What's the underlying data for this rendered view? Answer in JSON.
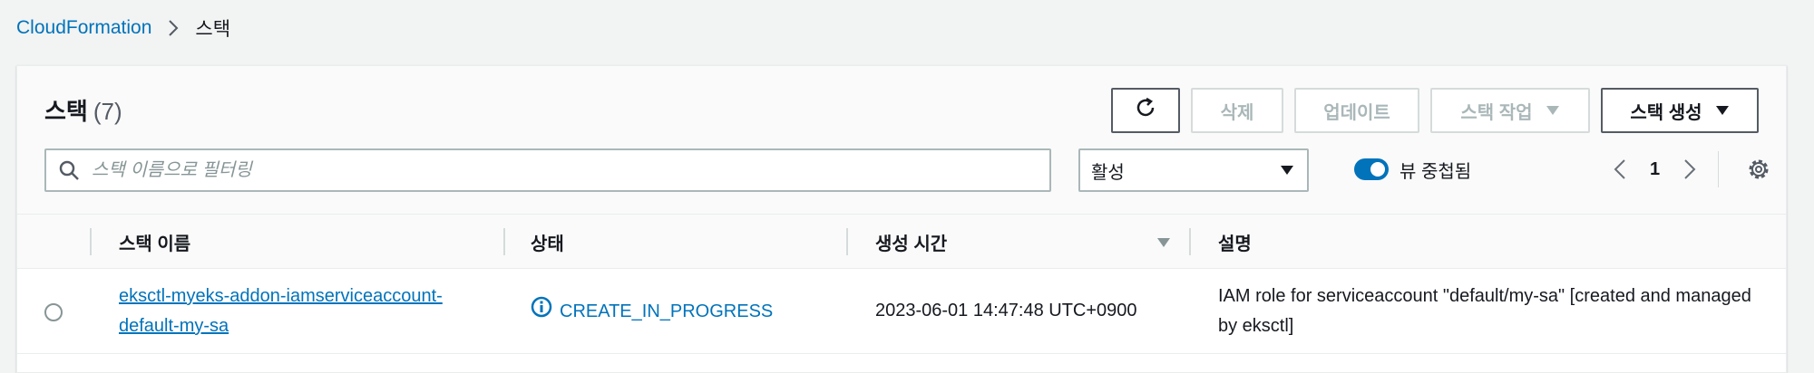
{
  "breadcrumb": {
    "root": "CloudFormation",
    "current": "스택"
  },
  "header": {
    "title": "스택",
    "count": "(7)"
  },
  "toolbar": {
    "delete_label": "삭제",
    "update_label": "업데이트",
    "stack_actions_label": "스택 작업",
    "create_stack_label": "스택 생성"
  },
  "filter": {
    "search_placeholder": "스택 이름으로 필터링",
    "status_select_value": "활성",
    "nested_view_label": "뷰 중첩됨",
    "nested_view_on": true
  },
  "pagination": {
    "current_page": "1"
  },
  "table": {
    "columns": [
      "스택 이름",
      "상태",
      "생성 시간",
      "설명"
    ],
    "rows": [
      {
        "name": "eksctl-myeks-addon-iamserviceaccount-default-my-sa",
        "status": "CREATE_IN_PROGRESS",
        "created": "2023-06-01 14:47:48 UTC+0900",
        "description": "IAM role for serviceaccount \"default/my-sa\" [created and managed by eksctl]"
      }
    ]
  },
  "colors": {
    "link": "#0073bb",
    "border": "#aab7b8",
    "disabled_text": "#aab7b8"
  }
}
